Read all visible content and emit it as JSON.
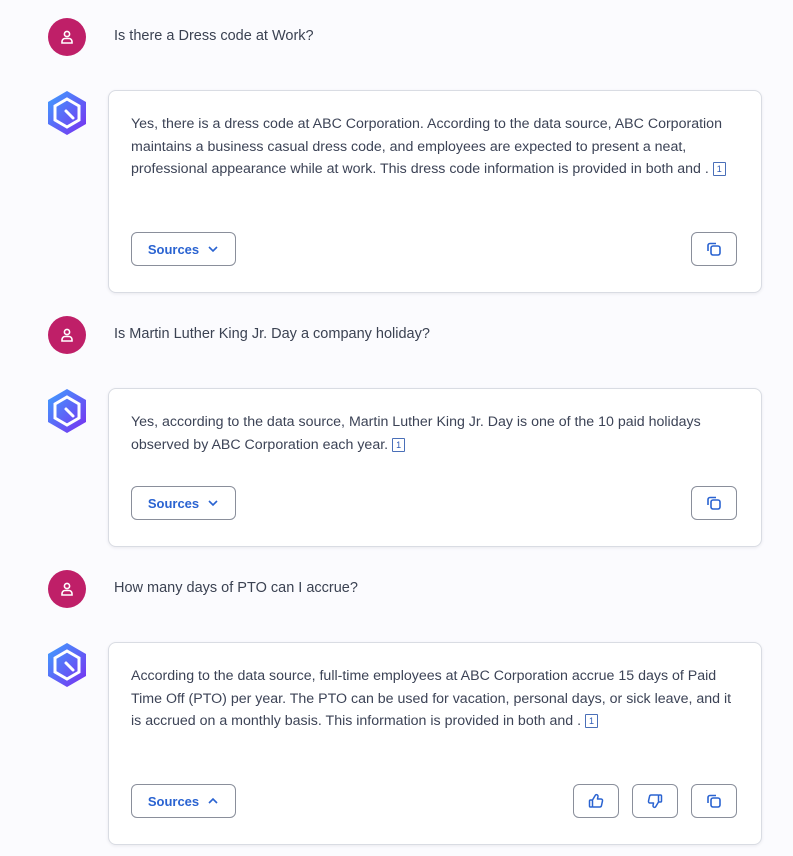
{
  "conversation": [
    {
      "question": "Is there a Dress code at Work?",
      "answer": "Yes, there is a dress code at ABC Corporation. According to the data source, ABC Corporation maintains a business casual dress code, and employees are expected to present a neat, professional appearance while at work. This dress code information is provided in both and .",
      "citation": "1",
      "sources_label": "Sources",
      "sources_state": "collapsed",
      "sources_icon": "chevron-down-icon",
      "actions": [
        "copy-icon"
      ]
    },
    {
      "question": "Is Martin Luther King Jr. Day a company holiday?",
      "answer": "Yes, according to the data source, Martin Luther King Jr. Day is one of the 10 paid holidays observed by ABC Corporation each year.",
      "citation": "1",
      "sources_label": "Sources",
      "sources_state": "collapsed",
      "sources_icon": "chevron-down-icon",
      "actions": [
        "copy-icon"
      ]
    },
    {
      "question": "How many days of PTO can I accrue?",
      "answer": "According to the data source, full-time employees at ABC Corporation accrue 15 days of Paid Time Off (PTO) per year. The PTO can be used for vacation, personal days, or sick leave, and it is accrued on a monthly basis. This information is provided in both and .",
      "citation": "1",
      "sources_label": "Sources",
      "sources_state": "expanded",
      "sources_icon": "chevron-up-icon",
      "actions": [
        "thumbs-up-icon",
        "thumbs-down-icon",
        "copy-icon"
      ]
    }
  ],
  "colors": {
    "user_avatar": "#bf1f68",
    "accent": "#2a63d1",
    "bot_gradient_start": "#3ea1ff",
    "bot_gradient_end": "#7a2df0"
  }
}
